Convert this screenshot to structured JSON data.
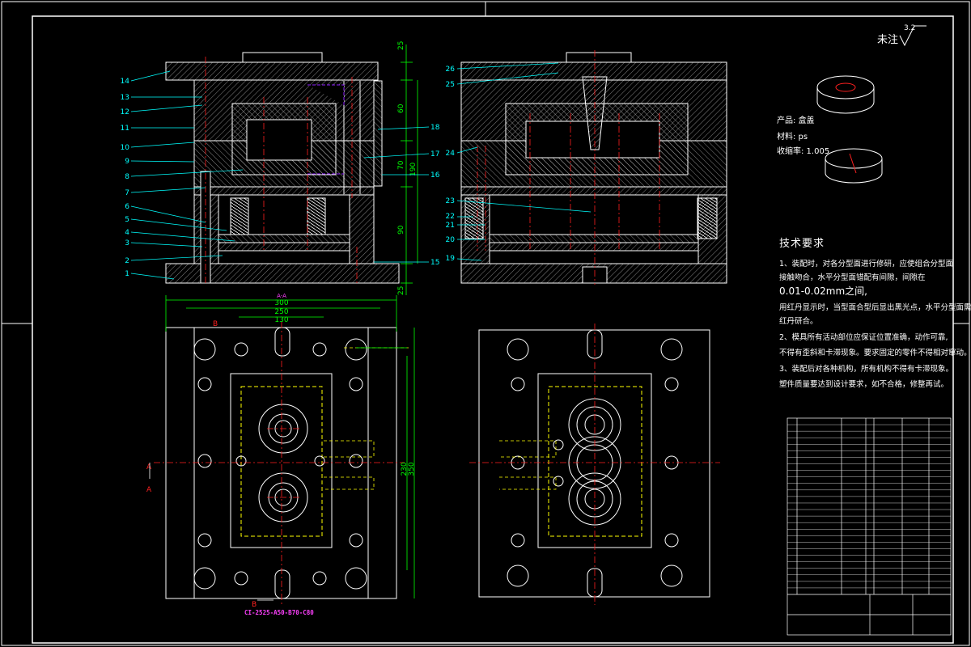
{
  "drawing": {
    "roughness_note": "未注",
    "roughness_value": "3.2",
    "section_label": "A-A",
    "std_mold_base": "CI-2525-A50-B70-C80"
  },
  "product": {
    "name_line": "产品: 盒盖",
    "material_line": "材料: ps",
    "shrink_line": "收缩率: 1.005"
  },
  "tech_requirements": {
    "title": "技术要求",
    "lines": [
      "1、装配时，对各分型面进行修研，应使组合分型面",
      "接触吻合，水平分型面错配有间隙，间隙在",
      "0.01-0.02mm之间,",
      "用红丹显示时，当型面合型后显出黑光点，水平分型面需用",
      "红丹研合。",
      "2、模具所有活动部位应保证位置准确，动作可靠,",
      "不得有歪斜和卡滞现象。要求固定的零件不得相对窜动。",
      "3、装配后对各种机构，所有机构不得有卡滞现象。",
      "塑件质量要达到设计要求，如不合格，修整再试。"
    ]
  },
  "dims": {
    "top": [
      "300",
      "250",
      "130"
    ],
    "right_overall": [
      "230",
      "350"
    ],
    "side_stack": [
      "25",
      "60",
      "70",
      "190",
      "90",
      "25"
    ],
    "center_label": "B"
  },
  "part_numbers_left": [
    "14",
    "13",
    "12",
    "11",
    "10",
    "9",
    "8",
    "7",
    "6",
    "5",
    "4",
    "3",
    "2",
    "1"
  ],
  "part_numbers_mid": [
    "18",
    "17",
    "16",
    "15"
  ],
  "part_numbers_right": [
    "26",
    "25",
    "24",
    "23",
    "22",
    "21",
    "20",
    "19"
  ],
  "view_letters": {
    "a_top": "A",
    "a_bottom": "A",
    "b_top": "B",
    "b_bottom": "B"
  },
  "colors": {
    "line": "#ffffff",
    "dim": "#00ff00",
    "center": "#ff2020",
    "leader": "#00ffff",
    "hidden": "#ffff00",
    "accent": "#9020ff"
  }
}
